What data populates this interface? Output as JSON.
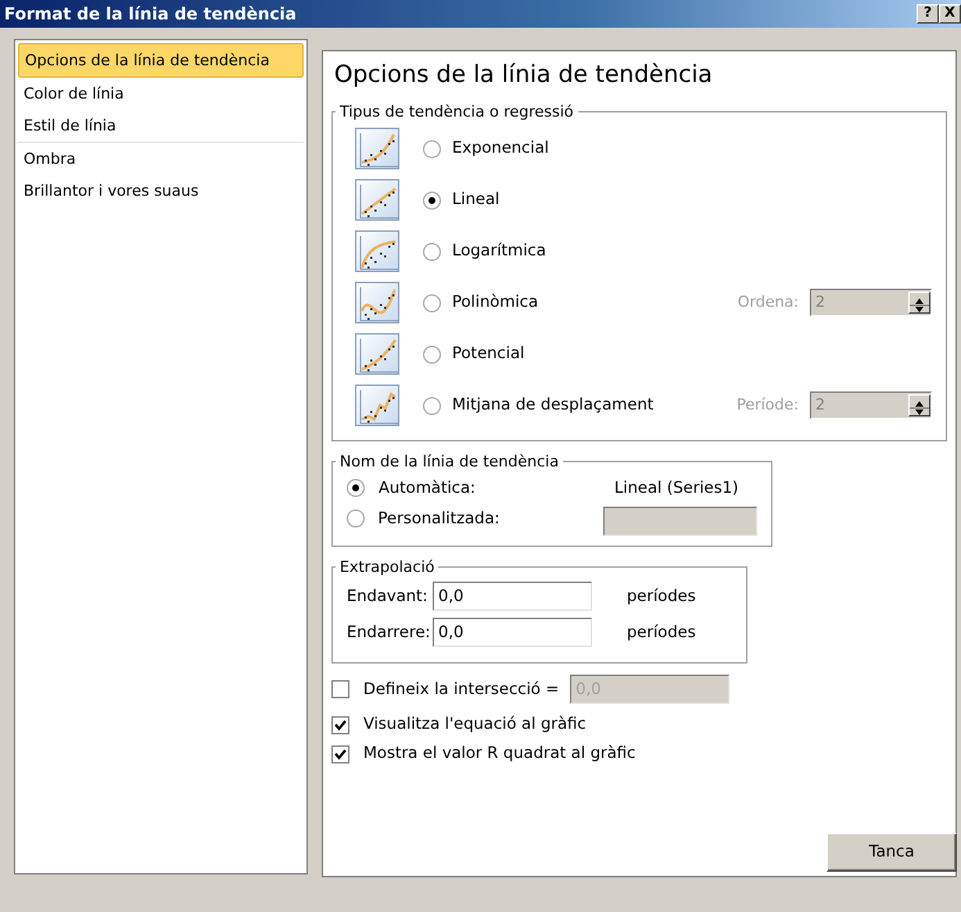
{
  "window": {
    "title": "Format de la línia de tendència",
    "help_button": "?",
    "close_button": "X"
  },
  "sidebar": {
    "items": [
      {
        "label": "Opcions de la línia de tendència",
        "selected": true,
        "separator_after": false
      },
      {
        "label": "Color de línia",
        "selected": false,
        "separator_after": false
      },
      {
        "label": "Estil de línia",
        "selected": false,
        "separator_after": true
      },
      {
        "label": "Ombra",
        "selected": false,
        "separator_after": false
      },
      {
        "label": "Brillantor i vores suaus",
        "selected": false,
        "separator_after": false
      }
    ]
  },
  "panel": {
    "heading": "Opcions de la línia de tendència",
    "trend_type": {
      "legend": "Tipus de tendència o regressió",
      "options": [
        {
          "kind": "exponential",
          "label": "Exponencial",
          "selected": false
        },
        {
          "kind": "linear",
          "label": "Lineal",
          "selected": true
        },
        {
          "kind": "logarithmic",
          "label": "Logarítmica",
          "selected": false
        },
        {
          "kind": "polynomial",
          "label": "Polinòmica",
          "selected": false,
          "spinner": {
            "label": "Ordena:",
            "value": "2",
            "disabled": true
          }
        },
        {
          "kind": "power",
          "label": "Potencial",
          "selected": false
        },
        {
          "kind": "moving",
          "label": "Mitjana de desplaçament",
          "selected": false,
          "spinner": {
            "label": "Període:",
            "value": "2",
            "disabled": true
          }
        }
      ]
    },
    "trend_name": {
      "legend": "Nom de la línia de tendència",
      "options": [
        {
          "kind": "text",
          "label": "Automàtica:",
          "selected": true,
          "value": "Lineal (Series1)"
        },
        {
          "kind": "field",
          "label": "Personalitzada:",
          "selected": false,
          "disabled": true
        }
      ]
    },
    "extrapolation": {
      "legend": "Extrapolació",
      "rows": [
        {
          "label": "Endavant:",
          "value": "0,0",
          "unit": "períodes"
        },
        {
          "label": "Endarrere:",
          "value": "0,0",
          "unit": "períodes"
        }
      ]
    },
    "checks": [
      {
        "label": "Defineix la intersecció =",
        "checked": false,
        "field": {
          "value": "0,0",
          "disabled": true
        }
      },
      {
        "label": "Visualitza l'equació al gràfic",
        "checked": true
      },
      {
        "label": "Mostra el valor R quadrat al gràfic",
        "checked": true
      }
    ]
  },
  "buttons": [
    {
      "label": "Tanca"
    }
  ]
}
